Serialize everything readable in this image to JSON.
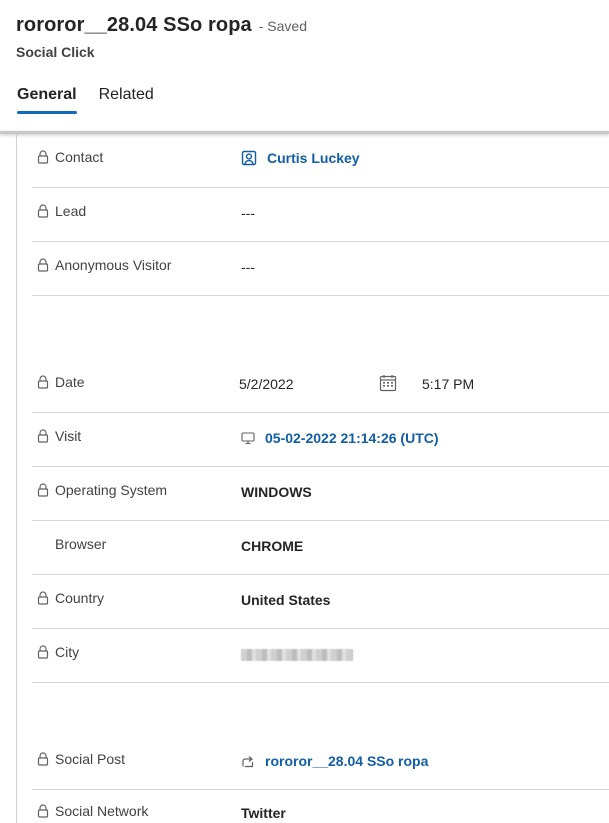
{
  "header": {
    "title": "rororor__28.04 SSo ropa",
    "saved_status": "- Saved",
    "entity": "Social Click"
  },
  "tabs": [
    {
      "label": "General",
      "active": true
    },
    {
      "label": "Related",
      "active": false
    }
  ],
  "fields": {
    "contact": {
      "label": "Contact",
      "value": "Curtis Luckey"
    },
    "lead": {
      "label": "Lead",
      "value": "---"
    },
    "anonymous_visitor": {
      "label": "Anonymous Visitor",
      "value": "---"
    },
    "date": {
      "label": "Date",
      "date_value": "5/2/2022",
      "time_value": "5:17 PM"
    },
    "visit": {
      "label": "Visit",
      "value": "05-02-2022 21:14:26 (UTC)"
    },
    "operating_system": {
      "label": "Operating System",
      "value": "WINDOWS"
    },
    "browser": {
      "label": "Browser",
      "value": "CHROME"
    },
    "country": {
      "label": "Country",
      "value": "United States"
    },
    "city": {
      "label": "City"
    },
    "social_post": {
      "label": "Social Post",
      "value": "rororor__28.04 SSo ropa"
    },
    "social_network": {
      "label": "Social Network",
      "value": "Twitter"
    }
  },
  "icons": {
    "lock": "lock-icon",
    "contact": "contact-card-icon",
    "visit": "monitor-icon",
    "calendar": "calendar-icon",
    "social_post": "share-icon"
  },
  "colors": {
    "accent": "#0f6cbd",
    "link": "#115ea3"
  }
}
